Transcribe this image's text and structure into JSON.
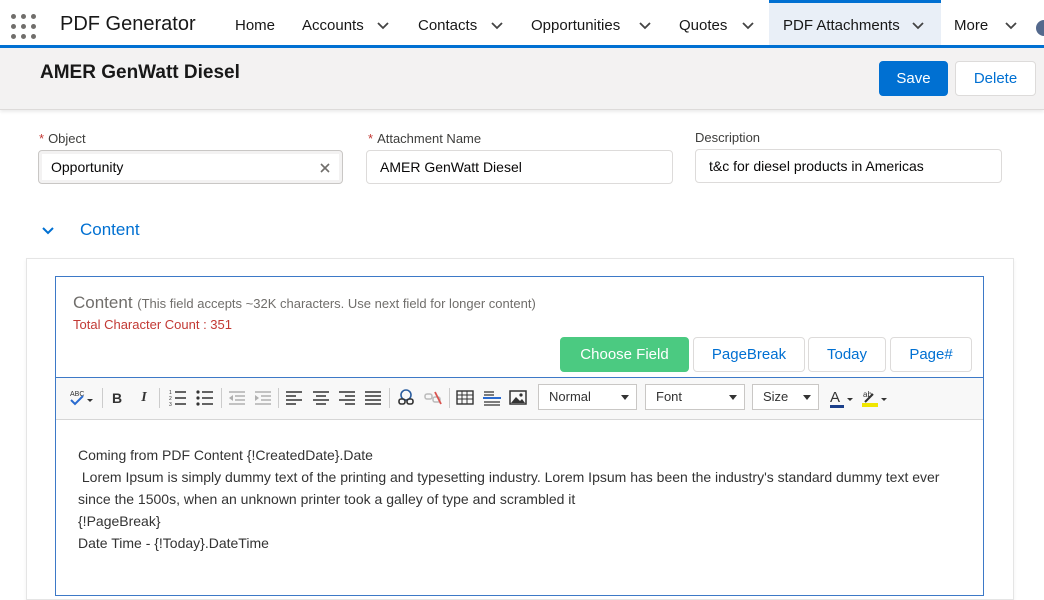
{
  "app": {
    "name": "PDF Generator",
    "nav": [
      {
        "label": "Home",
        "has_menu": false,
        "active": false
      },
      {
        "label": "Accounts",
        "has_menu": true,
        "active": false
      },
      {
        "label": "Contacts",
        "has_menu": true,
        "active": false
      },
      {
        "label": "Opportunities",
        "has_menu": true,
        "active": false
      },
      {
        "label": "Quotes",
        "has_menu": true,
        "active": false
      },
      {
        "label": "PDF Attachments",
        "has_menu": true,
        "active": true
      },
      {
        "label": "More",
        "has_menu": true,
        "active": false
      }
    ]
  },
  "record": {
    "title": "AMER GenWatt Diesel",
    "save_label": "Save",
    "delete_label": "Delete"
  },
  "fields": {
    "object": {
      "label": "Object",
      "required": "*",
      "value": "Opportunity"
    },
    "attachment_name": {
      "label": "Attachment Name",
      "required": "*",
      "value": "AMER GenWatt Diesel"
    },
    "description": {
      "label": "Description",
      "value": "t&c for diesel products in Americas"
    }
  },
  "section": {
    "title": "Content",
    "content_label": "Content",
    "content_note": "(This field accepts ~32K characters. Use next field for longer content)",
    "char_count": "Total Character Count : 351",
    "buttons": {
      "choose_field": "Choose Field",
      "page_break": "PageBreak",
      "today": "Today",
      "page_num": "Page#"
    }
  },
  "editor": {
    "format_select": "Normal",
    "font_select": "Font",
    "size_select": "Size",
    "lines": [
      "Coming from PDF Content {!CreatedDate}.Date",
      " Lorem Ipsum is simply dummy text of the printing and typesetting industry. Lorem Ipsum has been the industry's standard dummy text ever since the 1500s, when an unknown printer took a galley of type and scrambled it",
      "{!PageBreak}",
      "Date Time - {!Today}.DateTime"
    ]
  },
  "colors": {
    "brand": "#0070d2",
    "success": "#4bca81",
    "error": "#c23934"
  },
  "icons": {
    "app_launcher": "waffle-icon",
    "dropdown": "chevron-down-icon",
    "clear": "close-icon",
    "section_toggle": "chevron-down-icon"
  }
}
